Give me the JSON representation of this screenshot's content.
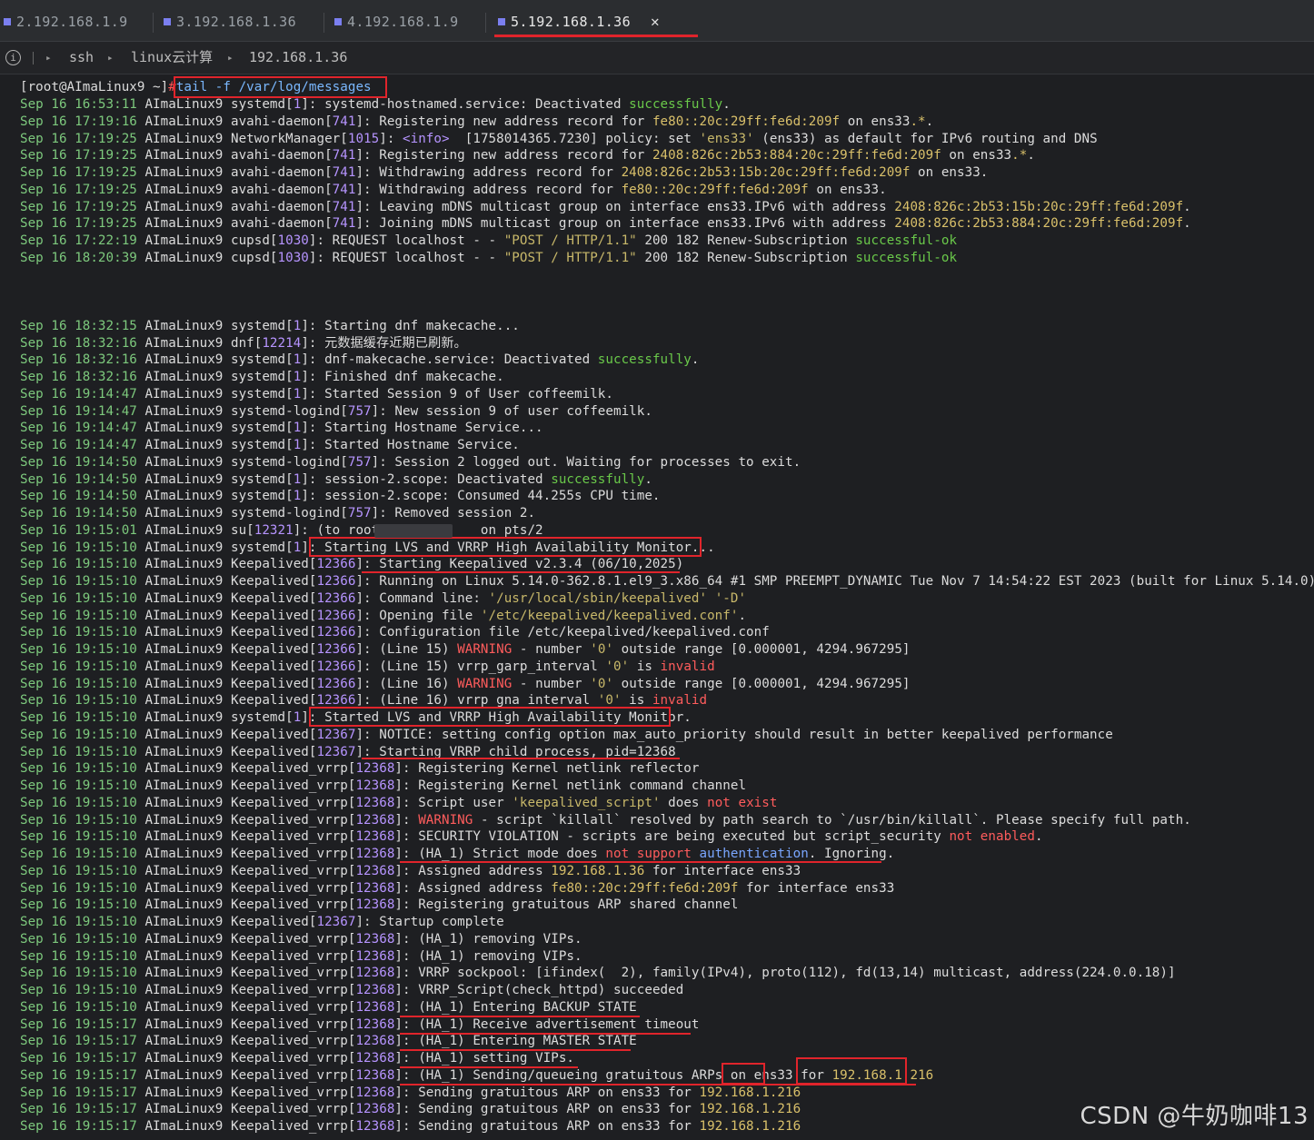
{
  "tabs": [
    {
      "label": "2.192.168.1.9",
      "active": false
    },
    {
      "label": "3.192.168.1.36",
      "active": false
    },
    {
      "label": "4.192.168.1.9",
      "active": false
    },
    {
      "label": "5.192.168.1.36",
      "active": true
    }
  ],
  "tab_close_glyph": "✕",
  "breadcrumb": {
    "info_icon": "i",
    "items": [
      "ssh",
      "linux云计算",
      "192.168.1.36"
    ]
  },
  "prompt": {
    "user_host": "[root@AImaLinux9 ~]",
    "hash": "#",
    "command": "tail -f /var/log/messages"
  },
  "log_lines": [
    "Sep 16 16:53:11 AImaLinux9 systemd[1]: systemd-hostnamed.service: Deactivated successfully.",
    "Sep 16 17:19:16 AImaLinux9 avahi-daemon[741]: Registering new address record for fe80::20c:29ff:fe6d:209f on ens33.*.",
    "Sep 16 17:19:25 AImaLinux9 NetworkManager[1015]: <info>  [1758014365.7230] policy: set 'ens33' (ens33) as default for IPv6 routing and DNS",
    "Sep 16 17:19:25 AImaLinux9 avahi-daemon[741]: Registering new address record for 2408:826c:2b53:884:20c:29ff:fe6d:209f on ens33.*.",
    "Sep 16 17:19:25 AImaLinux9 avahi-daemon[741]: Withdrawing address record for 2408:826c:2b53:15b:20c:29ff:fe6d:209f on ens33.",
    "Sep 16 17:19:25 AImaLinux9 avahi-daemon[741]: Withdrawing address record for fe80::20c:29ff:fe6d:209f on ens33.",
    "Sep 16 17:19:25 AImaLinux9 avahi-daemon[741]: Leaving mDNS multicast group on interface ens33.IPv6 with address 2408:826c:2b53:15b:20c:29ff:fe6d:209f.",
    "Sep 16 17:19:25 AImaLinux9 avahi-daemon[741]: Joining mDNS multicast group on interface ens33.IPv6 with address 2408:826c:2b53:884:20c:29ff:fe6d:209f.",
    "Sep 16 17:22:19 AImaLinux9 cupsd[1030]: REQUEST localhost - - \"POST / HTTP/1.1\" 200 182 Renew-Subscription successful-ok",
    "Sep 16 18:20:39 AImaLinux9 cupsd[1030]: REQUEST localhost - - \"POST / HTTP/1.1\" 200 182 Renew-Subscription successful-ok",
    "",
    "",
    "",
    "Sep 16 18:32:15 AImaLinux9 systemd[1]: Starting dnf makecache...",
    "Sep 16 18:32:16 AImaLinux9 dnf[12214]: 元数据缓存近期已刷新。",
    "Sep 16 18:32:16 AImaLinux9 systemd[1]: dnf-makecache.service: Deactivated successfully.",
    "Sep 16 18:32:16 AImaLinux9 systemd[1]: Finished dnf makecache.",
    "Sep 16 19:14:47 AImaLinux9 systemd[1]: Started Session 9 of User coffeemilk.",
    "Sep 16 19:14:47 AImaLinux9 systemd-logind[757]: New session 9 of user coffeemilk.",
    "Sep 16 19:14:47 AImaLinux9 systemd[1]: Starting Hostname Service...",
    "Sep 16 19:14:47 AImaLinux9 systemd[1]: Started Hostname Service.",
    "Sep 16 19:14:50 AImaLinux9 systemd-logind[757]: Session 2 logged out. Waiting for processes to exit.",
    "Sep 16 19:14:50 AImaLinux9 systemd[1]: session-2.scope: Deactivated successfully.",
    "Sep 16 19:14:50 AImaLinux9 systemd[1]: session-2.scope: Consumed 44.255s CPU time.",
    "Sep 16 19:14:50 AImaLinux9 systemd-logind[757]: Removed session 2.",
    "Sep 16 19:15:01 AImaLinux9 su[12321]: (to root)            on pts/2",
    "Sep 16 19:15:10 AImaLinux9 systemd[1]: Starting LVS and VRRP High Availability Monitor...",
    "Sep 16 19:15:10 AImaLinux9 Keepalived[12366]: Starting Keepalived v2.3.4 (06/10,2025)",
    "Sep 16 19:15:10 AImaLinux9 Keepalived[12366]: Running on Linux 5.14.0-362.8.1.el9_3.x86_64 #1 SMP PREEMPT_DYNAMIC Tue Nov 7 14:54:22 EST 2023 (built for Linux 5.14.0)",
    "Sep 16 19:15:10 AImaLinux9 Keepalived[12366]: Command line: '/usr/local/sbin/keepalived' '-D'",
    "Sep 16 19:15:10 AImaLinux9 Keepalived[12366]: Opening file '/etc/keepalived/keepalived.conf'.",
    "Sep 16 19:15:10 AImaLinux9 Keepalived[12366]: Configuration file /etc/keepalived/keepalived.conf",
    "Sep 16 19:15:10 AImaLinux9 Keepalived[12366]: (Line 15) WARNING - number '0' outside range [0.000001, 4294.967295]",
    "Sep 16 19:15:10 AImaLinux9 Keepalived[12366]: (Line 15) vrrp_garp_interval '0' is invalid",
    "Sep 16 19:15:10 AImaLinux9 Keepalived[12366]: (Line 16) WARNING - number '0' outside range [0.000001, 4294.967295]",
    "Sep 16 19:15:10 AImaLinux9 Keepalived[12366]: (Line 16) vrrp_gna_interval '0' is invalid",
    "Sep 16 19:15:10 AImaLinux9 systemd[1]: Started LVS and VRRP High Availability Monitor.",
    "Sep 16 19:15:10 AImaLinux9 Keepalived[12367]: NOTICE: setting config option max_auto_priority should result in better keepalived performance",
    "Sep 16 19:15:10 AImaLinux9 Keepalived[12367]: Starting VRRP child process, pid=12368",
    "Sep 16 19:15:10 AImaLinux9 Keepalived_vrrp[12368]: Registering Kernel netlink reflector",
    "Sep 16 19:15:10 AImaLinux9 Keepalived_vrrp[12368]: Registering Kernel netlink command channel",
    "Sep 16 19:15:10 AImaLinux9 Keepalived_vrrp[12368]: Script user 'keepalived_script' does not exist",
    "Sep 16 19:15:10 AImaLinux9 Keepalived_vrrp[12368]: WARNING - script `killall` resolved by path search to `/usr/bin/killall`. Please specify full path.",
    "Sep 16 19:15:10 AImaLinux9 Keepalived_vrrp[12368]: SECURITY VIOLATION - scripts are being executed but script_security not enabled.",
    "Sep 16 19:15:10 AImaLinux9 Keepalived_vrrp[12368]: (HA_1) Strict mode does not support authentication. Ignoring.",
    "Sep 16 19:15:10 AImaLinux9 Keepalived_vrrp[12368]: Assigned address 192.168.1.36 for interface ens33",
    "Sep 16 19:15:10 AImaLinux9 Keepalived_vrrp[12368]: Assigned address fe80::20c:29ff:fe6d:209f for interface ens33",
    "Sep 16 19:15:10 AImaLinux9 Keepalived_vrrp[12368]: Registering gratuitous ARP shared channel",
    "Sep 16 19:15:10 AImaLinux9 Keepalived[12367]: Startup complete",
    "Sep 16 19:15:10 AImaLinux9 Keepalived_vrrp[12368]: (HA_1) removing VIPs.",
    "Sep 16 19:15:10 AImaLinux9 Keepalived_vrrp[12368]: (HA_1) removing VIPs.",
    "Sep 16 19:15:10 AImaLinux9 Keepalived_vrrp[12368]: VRRP sockpool: [ifindex(  2), family(IPv4), proto(112), fd(13,14) multicast, address(224.0.0.18)]",
    "Sep 16 19:15:10 AImaLinux9 Keepalived_vrrp[12368]: VRRP_Script(check_httpd) succeeded",
    "Sep 16 19:15:10 AImaLinux9 Keepalived_vrrp[12368]: (HA_1) Entering BACKUP STATE",
    "Sep 16 19:15:17 AImaLinux9 Keepalived_vrrp[12368]: (HA_1) Receive advertisement timeout",
    "Sep 16 19:15:17 AImaLinux9 Keepalived_vrrp[12368]: (HA_1) Entering MASTER STATE",
    "Sep 16 19:15:17 AImaLinux9 Keepalived_vrrp[12368]: (HA_1) setting VIPs.",
    "Sep 16 19:15:17 AImaLinux9 Keepalived_vrrp[12368]: (HA_1) Sending/queueing gratuitous ARPs on ens33 for 192.168.1.216",
    "Sep 16 19:15:17 AImaLinux9 Keepalived_vrrp[12368]: Sending gratuitous ARP on ens33 for 192.168.1.216",
    "Sep 16 19:15:17 AImaLinux9 Keepalived_vrrp[12368]: Sending gratuitous ARP on ens33 for 192.168.1.216",
    "Sep 16 19:15:17 AImaLinux9 Keepalived_vrrp[12368]: Sending gratuitous ARP on ens33 for 192.168.1.216"
  ],
  "watermark": "CSDN @牛奶咖啡13",
  "colors": {
    "timestamp": "#7dc97d",
    "number": "#b694ff",
    "success": "#6ac94a",
    "warning": "#ff5c5c",
    "string": "#c8b86a",
    "annotation": "#e0242b"
  }
}
